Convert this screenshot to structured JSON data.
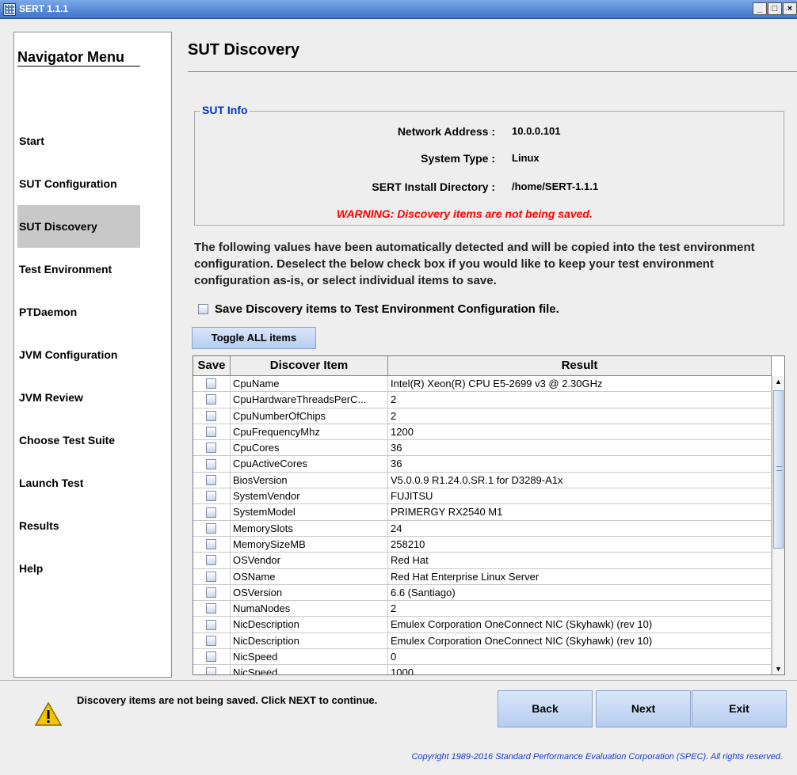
{
  "window": {
    "title": "SERT 1.1.1",
    "controls": [
      "_",
      "□",
      "×"
    ]
  },
  "nav": {
    "title": "Navigator Menu",
    "items": [
      {
        "label": "Start",
        "active": false
      },
      {
        "label": "SUT Configuration",
        "active": false
      },
      {
        "label": "SUT Discovery",
        "active": true
      },
      {
        "label": "Test Environment",
        "active": false
      },
      {
        "label": "PTDaemon",
        "active": false
      },
      {
        "label": "JVM Configuration",
        "active": false
      },
      {
        "label": "JVM Review",
        "active": false
      },
      {
        "label": "Choose Test Suite",
        "active": false
      },
      {
        "label": "Launch Test",
        "active": false
      },
      {
        "label": "Results",
        "active": false
      },
      {
        "label": "Help",
        "active": false
      }
    ]
  },
  "page": {
    "title": "SUT Discovery"
  },
  "sut_info": {
    "legend": "SUT Info",
    "network_label": "Network Address :",
    "network_value": "10.0.0.101",
    "system_label": "System Type :",
    "system_value": "Linux",
    "dir_label": "SERT Install Directory :",
    "dir_value": "/home/SERT-1.1.1",
    "warning": "WARNING: Discovery items are not being saved."
  },
  "description": "The following values have been automatically detected and will be copied into the test environment configuration. Deselect the below check box if you would like to keep your test environment configuration as-is, or select individual items to save.",
  "save_checkbox": {
    "label": "Save Discovery items to Test Environment Configuration file.",
    "checked": false
  },
  "toggle_button": "Toggle ALL items",
  "table": {
    "headers": [
      "Save",
      "Discover Item",
      "Result"
    ],
    "rows": [
      {
        "item": "CpuName",
        "result": "Intel(R) Xeon(R) CPU E5-2699 v3 @ 2.30GHz"
      },
      {
        "item": "CpuHardwareThreadsPerC...",
        "result": "2"
      },
      {
        "item": "CpuNumberOfChips",
        "result": "2"
      },
      {
        "item": "CpuFrequencyMhz",
        "result": "1200"
      },
      {
        "item": "CpuCores",
        "result": "36"
      },
      {
        "item": "CpuActiveCores",
        "result": "36"
      },
      {
        "item": "BiosVersion",
        "result": "V5.0.0.9 R1.24.0.SR.1 for D3289-A1x"
      },
      {
        "item": "SystemVendor",
        "result": "FUJITSU"
      },
      {
        "item": "SystemModel",
        "result": "PRIMERGY RX2540 M1"
      },
      {
        "item": "MemorySlots",
        "result": "24"
      },
      {
        "item": "MemorySizeMB",
        "result": "258210"
      },
      {
        "item": "OSVendor",
        "result": "Red Hat"
      },
      {
        "item": "OSName",
        "result": "Red Hat Enterprise Linux Server"
      },
      {
        "item": "OSVersion",
        "result": "6.6 (Santiago)"
      },
      {
        "item": "NumaNodes",
        "result": "2"
      },
      {
        "item": "NicDescription",
        "result": "Emulex Corporation OneConnect NIC (Skyhawk) (rev 10)"
      },
      {
        "item": "NicDescription",
        "result": "Emulex Corporation OneConnect NIC (Skyhawk) (rev 10)"
      },
      {
        "item": "NicSpeed",
        "result": "0"
      },
      {
        "item": "NicSpeed",
        "result": "1000"
      }
    ]
  },
  "status_message": "Discovery items are not being saved. Click NEXT to continue.",
  "buttons": {
    "back": "Back",
    "next": "Next",
    "exit": "Exit"
  },
  "copyright": "Copyright 1989-2016 Standard Performance Evaluation Corporation (SPEC). All rights reserved."
}
